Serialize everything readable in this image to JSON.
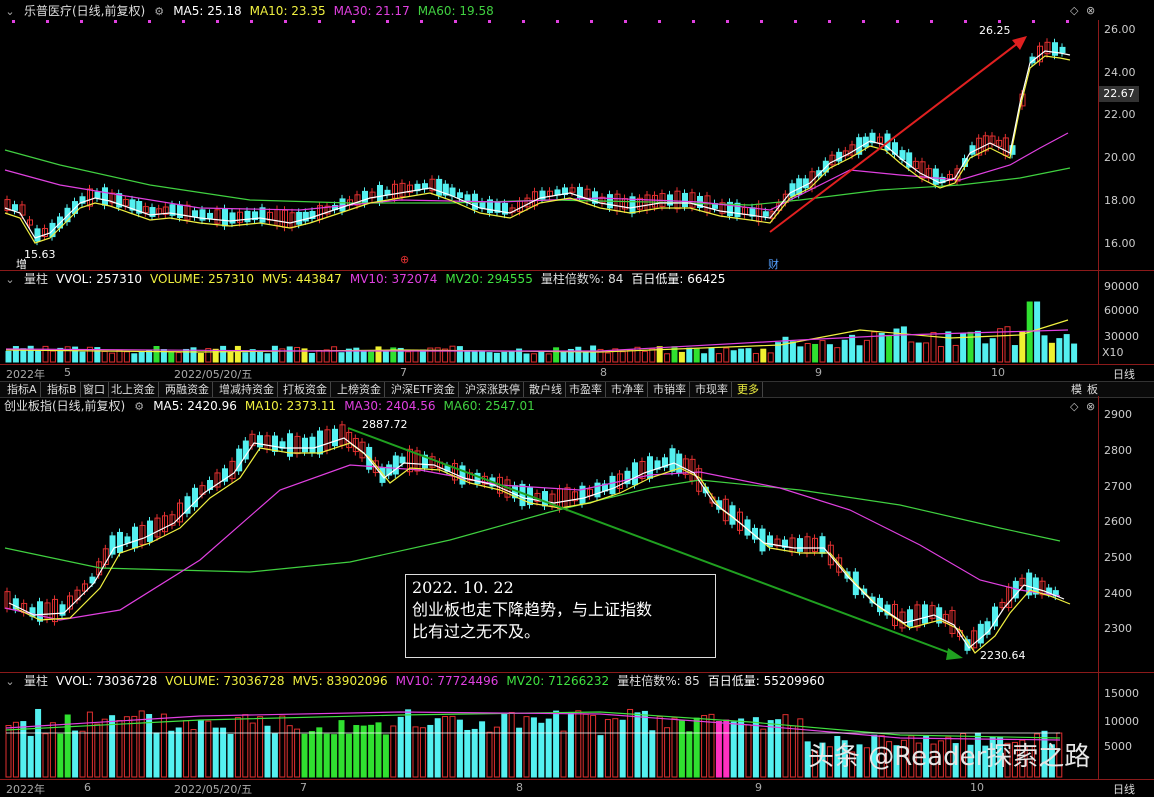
{
  "colors": {
    "up": "#e03030",
    "down": "#54f0f0",
    "ma5": "#ffffff",
    "ma10": "#f0f040",
    "ma30": "#e040e0",
    "ma60": "#40d040",
    "ma60b": "#40e040",
    "vol_yellow": "#f0f030",
    "vol_green": "#30e030",
    "vol_magenta": "#ff30c0",
    "arrow_red": "#e02020",
    "arrow_green": "#20a020"
  },
  "icons": {
    "collapse": "chevron-down-icon",
    "settings": "diamond-icon",
    "close": "close-icon"
  },
  "stock": {
    "header": {
      "name": "乐普医疗(日线,前复权)",
      "ma5": "MA5: 25.18",
      "ma10": "MA10: 23.35",
      "ma30": "MA30: 21.17",
      "ma60": "MA60: 19.58"
    },
    "current_price": "22.67",
    "high_label": "26.25",
    "low_label": "15.63",
    "markers": {
      "zeng": "增",
      "cai": "财",
      "note": "⊕"
    },
    "y_ticks": [
      "26.00",
      "24.00",
      "22.00",
      "20.00",
      "18.00",
      "16.00"
    ]
  },
  "stock_volume": {
    "header": {
      "name": "量柱",
      "vvol": "VVOL: 257310",
      "volume": "VOLUME: 257310",
      "mv5": "MV5: 443847",
      "mv10": "MV10: 372074",
      "mv20": "MV20: 294555",
      "ratio": "量柱倍数%: 84",
      "low": "百日低量: 66425"
    },
    "y_ticks": [
      "90000",
      "60000",
      "30000"
    ],
    "unit": "X10"
  },
  "stock_x_labels": [
    "2022年",
    "5",
    "2022/05/20/五",
    "7",
    "8",
    "9",
    "10"
  ],
  "period_label": "日线",
  "tabs": [
    "指标A",
    "指标B",
    "窗口",
    "北上资金",
    "两融资金",
    "增减持资金",
    "打板资金",
    "上榜资金",
    "沪深ETF资金",
    "沪深涨跌停",
    "散户线",
    "市盈率",
    "市净率",
    "市销率",
    "市现率",
    "更多"
  ],
  "tab_right": [
    "模",
    "板"
  ],
  "index": {
    "header": {
      "name": "创业板指(日线,前复权)",
      "ma5": "MA5: 2420.96",
      "ma10": "MA10: 2373.11",
      "ma30": "MA30: 2404.56",
      "ma60": "MA60: 2547.01"
    },
    "high_label": "2887.72",
    "low_label": "2230.64",
    "y_ticks": [
      "2900",
      "2800",
      "2700",
      "2600",
      "2500",
      "2400",
      "2300"
    ]
  },
  "index_volume": {
    "header": {
      "name": "量柱",
      "vvol": "VVOL: 73036728",
      "volume": "VOLUME: 73036728",
      "mv5": "MV5: 83902096",
      "mv10": "MV10: 77724496",
      "mv20": "MV20: 71266232",
      "ratio": "量柱倍数%: 85",
      "low": "百日低量: 55209960"
    },
    "y_ticks": [
      "15000",
      "10000",
      "5000"
    ]
  },
  "index_x_labels": [
    "2022年",
    "6",
    "2022/05/20/五",
    "7",
    "8",
    "9",
    "10"
  ],
  "annotation": {
    "line1": "2022. 10. 22",
    "line2": "创业板也走下降趋势，与上证指数",
    "line3": "比有过之无不及。"
  },
  "watermark": "头条 @Reader探索之路"
}
